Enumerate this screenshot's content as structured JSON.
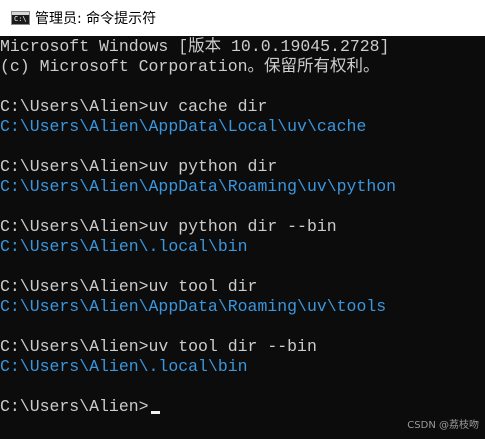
{
  "window": {
    "title": "管理员: 命令提示符",
    "icon": "cmd-icon",
    "icon_text": "C:\\"
  },
  "console": {
    "lines": [
      {
        "type": "out",
        "text": "Microsoft Windows [版本 10.0.19045.2728]"
      },
      {
        "type": "out",
        "text": "(c) Microsoft Corporation。保留所有权利。"
      },
      {
        "type": "blank",
        "text": ""
      },
      {
        "type": "cmd",
        "text": "C:\\Users\\Alien>uv cache dir"
      },
      {
        "type": "path",
        "text": "C:\\Users\\Alien\\AppData\\Local\\uv\\cache"
      },
      {
        "type": "blank",
        "text": ""
      },
      {
        "type": "cmd",
        "text": "C:\\Users\\Alien>uv python dir"
      },
      {
        "type": "path",
        "text": "C:\\Users\\Alien\\AppData\\Roaming\\uv\\python"
      },
      {
        "type": "blank",
        "text": ""
      },
      {
        "type": "cmd",
        "text": "C:\\Users\\Alien>uv python dir --bin"
      },
      {
        "type": "path",
        "text": "C:\\Users\\Alien\\.local\\bin"
      },
      {
        "type": "blank",
        "text": ""
      },
      {
        "type": "cmd",
        "text": "C:\\Users\\Alien>uv tool dir"
      },
      {
        "type": "path",
        "text": "C:\\Users\\Alien\\AppData\\Roaming\\uv\\tools"
      },
      {
        "type": "blank",
        "text": ""
      },
      {
        "type": "cmd",
        "text": "C:\\Users\\Alien>uv tool dir --bin"
      },
      {
        "type": "path",
        "text": "C:\\Users\\Alien\\.local\\bin"
      },
      {
        "type": "blank",
        "text": ""
      },
      {
        "type": "prompt",
        "text": "C:\\Users\\Alien>"
      }
    ]
  },
  "watermark": "CSDN @荔枝吻",
  "colors": {
    "background": "#0c0c0c",
    "text": "#cccccc",
    "path": "#3a96dd",
    "titlebar": "#ffffff"
  }
}
